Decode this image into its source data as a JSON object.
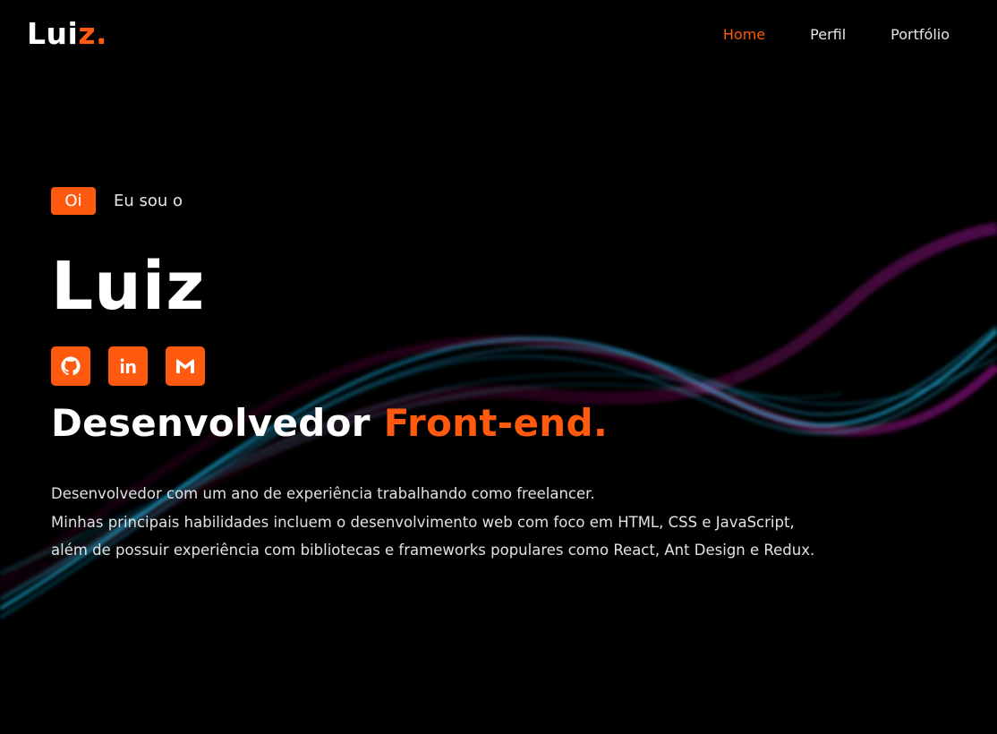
{
  "header": {
    "logo_main": "Lui",
    "logo_accent": "z.",
    "nav": [
      {
        "label": "Home",
        "active": true
      },
      {
        "label": "Perfil",
        "active": false
      },
      {
        "label": "Portfólio",
        "active": false
      }
    ]
  },
  "hero": {
    "badge": "Oi",
    "intro": "Eu sou o",
    "name": "Luiz",
    "socials": [
      {
        "icon": "github-icon"
      },
      {
        "icon": "linkedin-icon"
      },
      {
        "icon": "gmail-icon"
      }
    ],
    "role_main": "Desenvolvedor ",
    "role_accent": "Front-end.",
    "description": [
      "Desenvolvedor com um ano de experiência trabalhando como freelancer.",
      "Minhas principais habilidades incluem o desenvolvimento web com foco em HTML, CSS e JavaScript,",
      "além de possuir experiência com bibliotecas e frameworks populares como React, Ant Design e Redux."
    ]
  },
  "colors": {
    "accent": "#ff5a0d",
    "background": "#000000",
    "wave_cyan": "#19c6f2",
    "wave_magenta": "#d11ad8"
  }
}
